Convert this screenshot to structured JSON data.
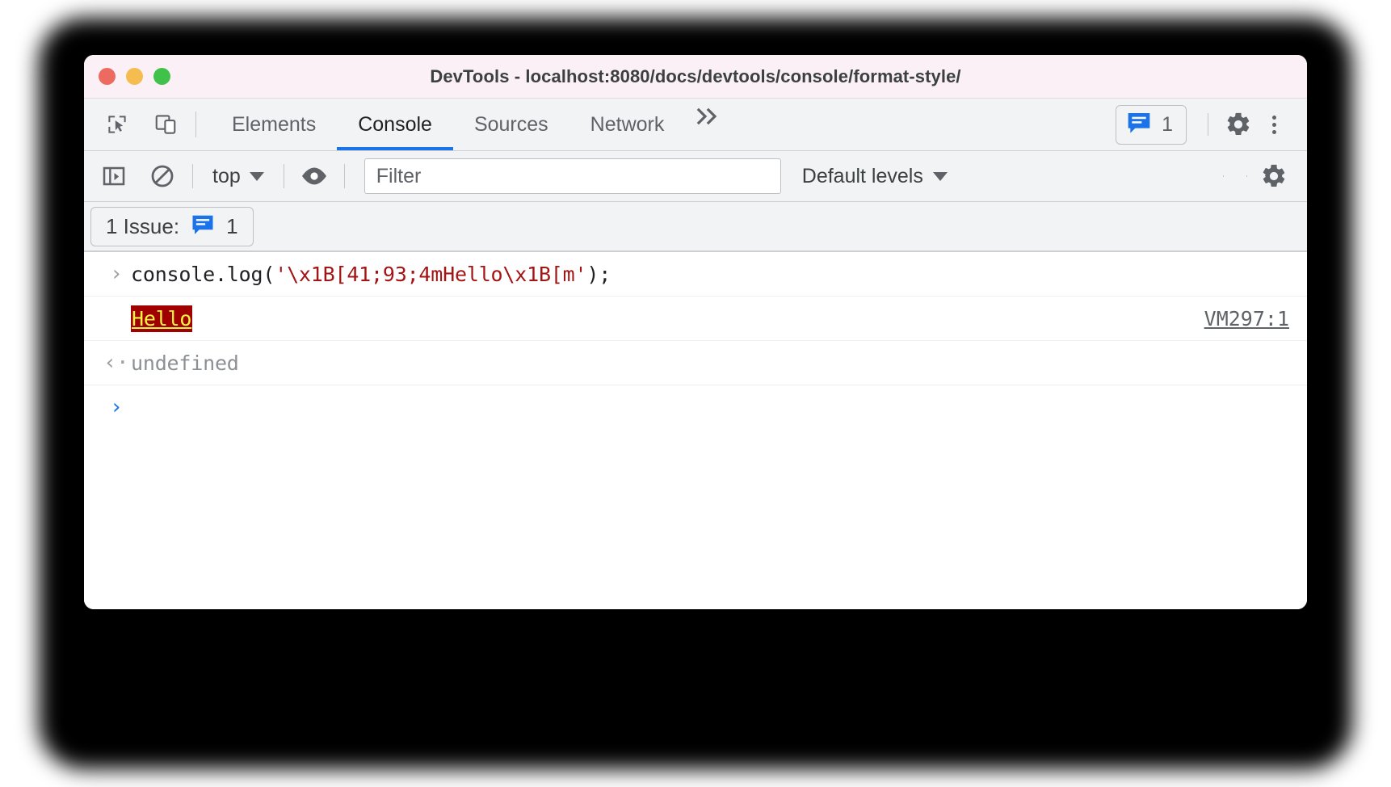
{
  "window": {
    "title": "DevTools - localhost:8080/docs/devtools/console/format-style/",
    "traffic_lights": [
      "close",
      "minimize",
      "zoom"
    ]
  },
  "tabbar": {
    "inspect_icon": "inspect-element-icon",
    "device_icon": "device-toolbar-icon",
    "tabs": [
      {
        "label": "Elements",
        "active": false
      },
      {
        "label": "Console",
        "active": true
      },
      {
        "label": "Sources",
        "active": false
      },
      {
        "label": "Network",
        "active": false
      }
    ],
    "overflow_label": "»",
    "issues_count": "1",
    "issues_icon": "issues-message-icon",
    "settings_icon": "gear-icon",
    "menu_icon": "kebab-menu-icon"
  },
  "console_toolbar": {
    "sidebar_icon": "console-sidebar-icon",
    "clear_icon": "clear-console-icon",
    "context": "top",
    "eye_icon": "live-expression-eye-icon",
    "filter_placeholder": "Filter",
    "filter_value": "",
    "levels": "Default levels",
    "settings_icon": "gear-icon"
  },
  "issues_bar": {
    "label": "1 Issue:",
    "badge_icon": "issues-message-icon",
    "count": "1"
  },
  "console": {
    "rows": [
      {
        "kind": "input",
        "marker": "›",
        "code_prefix": "console.log(",
        "code_string": "'\\x1B[41;93;4mHello\\x1B[m'",
        "code_suffix": ");"
      },
      {
        "kind": "output",
        "ansi_text": "Hello",
        "ansi_bg": "#a00000",
        "ansi_fg": "#f5f543",
        "ansi_underline": true,
        "source": "VM297:1"
      },
      {
        "kind": "result",
        "marker": "‹·",
        "value": "undefined"
      }
    ],
    "prompt_marker": "›",
    "prompt_value": ""
  },
  "colors": {
    "accent": "#1a73e8",
    "titlebar_bg": "#faf0f5",
    "toolbar_bg": "#f1f3f4",
    "string_red": "#a31515"
  }
}
